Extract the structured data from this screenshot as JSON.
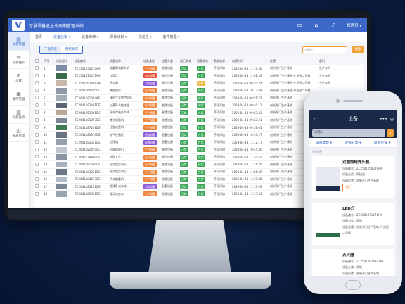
{
  "app": {
    "logo": "V",
    "title": "智慧设备全生命周期管理系统",
    "user": "管理员"
  },
  "topbar_icons": [
    "monitor-icon",
    "home-icon",
    "bell-icon"
  ],
  "sidebar": {
    "items": [
      {
        "icon": "▤",
        "label": "设备管理"
      },
      {
        "icon": "⚒",
        "label": "设备维护"
      },
      {
        "icon": "⚙",
        "label": "设置"
      },
      {
        "icon": "▦",
        "label": "备件管理"
      },
      {
        "icon": "▥",
        "label": "设备盘点"
      },
      {
        "icon": "◫",
        "label": "报表管理"
      }
    ]
  },
  "nav": {
    "tabs": [
      {
        "label": "首页"
      },
      {
        "label": "设备台账 ▾"
      },
      {
        "label": "设备维修 ▾"
      },
      {
        "label": "保养计划 ▾"
      },
      {
        "label": "点巡检 ▾"
      },
      {
        "label": "备件管理 ▾"
      }
    ]
  },
  "filter": {
    "seg": [
      "下发列表",
      "网络状况"
    ],
    "search_placeholder": "请输入",
    "search_label": "搜索"
  },
  "table": {
    "headers": [
      "",
      "序号",
      "设备图片",
      "设备编号",
      "设备名称",
      "设备类型",
      "设备分类",
      "运行状态",
      "设备状态",
      "数据来源",
      "创建时间",
      "位置",
      "部门",
      ""
    ],
    "rows": [
      {
        "n": "1",
        "code": "ZC2501250210HK",
        "name": "双圆筒电焊头机",
        "type": "生产设备",
        "tcolor": "orange",
        "cat": "制造设备",
        "run": "正常",
        "rcolor": "green",
        "state": "在用",
        "scolor": "green",
        "src": "手动添加",
        "time": "2023-04-18 11:13:56",
        "loc": "创新东门生产基地",
        "dept": "生产车间",
        "img": "#7c8ea5"
      },
      {
        "n": "2",
        "code": "ZC2501871071HK",
        "name": "LED灯",
        "type": "办公设备",
        "tcolor": "red",
        "cat": "制造设备",
        "run": "正常",
        "rcolor": "green",
        "state": "在用",
        "scolor": "green",
        "src": "手动添加",
        "time": "2023-04-18 11:01:34",
        "loc": "创新东门生产基地-产业园二号楼",
        "dept": "生产车间",
        "img": "#3a6a4a"
      },
      {
        "n": "3",
        "code": "ZC2501297491ZBF",
        "name": "灭火器",
        "type": "消防设备",
        "tcolor": "purple",
        "cat": "制造设备",
        "run": "正常",
        "rcolor": "green",
        "state": "维修",
        "scolor": "yellow",
        "src": "手动添加",
        "time": "2023-04-18 09:30:24",
        "loc": "创新东门生产基地-产业园二号楼",
        "dept": "生产车间",
        "img": "#c9b7a8"
      },
      {
        "n": "4",
        "code": "ZC2641160585DC",
        "name": "数控铣床",
        "type": "生产设备",
        "tcolor": "orange",
        "cat": "制造设备",
        "run": "正常",
        "rcolor": "green",
        "state": "在用",
        "scolor": "green",
        "src": "手动添加",
        "time": "2023-04-18 10:12:48",
        "loc": "创新东门生产基地-产业园二号楼",
        "dept": "",
        "img": "#8f98a6"
      },
      {
        "n": "5",
        "code": "ZC2641181084KE",
        "name": "精密立式数控机床",
        "type": "生产设备",
        "tcolor": "orange",
        "cat": "制造设备",
        "run": "正常",
        "rcolor": "green",
        "state": "在用",
        "scolor": "green",
        "src": "手动添加",
        "time": "2023-04-18 09:51:27",
        "loc": "创新东门生产基地",
        "dept": "",
        "img": "#a4acb8"
      },
      {
        "n": "6",
        "code": "ZC2641182401DE",
        "name": "三菱PLC控制器",
        "type": "生产设备",
        "tcolor": "orange",
        "cat": "制造设备",
        "run": "正常",
        "rcolor": "green",
        "state": "在用",
        "scolor": "green",
        "src": "手动添加",
        "time": "2023-04-18 09:40:11",
        "loc": "创新东门生产基地",
        "dept": "",
        "img": "#5a6578"
      },
      {
        "n": "7",
        "code": "ZC2641253361DC",
        "name": "粉末涂装生产线",
        "type": "生产设备",
        "tcolor": "orange",
        "cat": "制造设备",
        "run": "正常",
        "rcolor": "green",
        "state": "在用",
        "scolor": "green",
        "src": "手动添加",
        "time": "2023-04-18 09:53:42",
        "loc": "创新东门生产基地",
        "dept": "",
        "img": "#b9a894"
      },
      {
        "n": "8",
        "code": "ZC2641181057DE",
        "name": "激光切割机",
        "type": "生产设备",
        "tcolor": "orange",
        "cat": "制造设备",
        "run": "正常",
        "rcolor": "green",
        "state": "在用",
        "scolor": "green",
        "src": "手动添加",
        "time": "2023-04-18 09:23:41",
        "loc": "创新东门生产基地",
        "dept": "",
        "img": "#7b8592"
      },
      {
        "n": "9",
        "code": "ZC2641187101DE",
        "name": "注塑成型机",
        "type": "生产设备",
        "tcolor": "orange",
        "cat": "制造设备",
        "run": "正常",
        "rcolor": "green",
        "state": "在用",
        "scolor": "green",
        "src": "手动添加",
        "time": "2023-04-18 09:38:01",
        "loc": "创新东门生产基地",
        "dept": "",
        "img": "#3f7a55"
      },
      {
        "n": "10",
        "code": "ZC2641181910DE",
        "name": "电气控制柜",
        "type": "配套设备",
        "tcolor": "purple",
        "cat": "配套设备",
        "run": "正常",
        "rcolor": "green",
        "state": "在用",
        "scolor": "green",
        "src": "手动添加",
        "time": "2023-04-18 10:33:27",
        "loc": "创新东门生产基地",
        "dept": "",
        "img": "#6a7282"
      },
      {
        "n": "11",
        "code": "ZC2641181321DE",
        "name": "空压机",
        "type": "配套设备",
        "tcolor": "purple",
        "cat": "配套设备",
        "run": "正常",
        "rcolor": "green",
        "state": "在用",
        "scolor": "green",
        "src": "手动添加",
        "time": "2023-04-18 11:12:17",
        "loc": "创新东门生产基地",
        "dept": "",
        "img": "#98a0ad"
      },
      {
        "n": "12",
        "code": "ZC2641182450DC",
        "name": "机床防护门",
        "type": "生产设备",
        "tcolor": "orange",
        "cat": "制造设备",
        "run": "正常",
        "rcolor": "green",
        "state": "在用",
        "scolor": "green",
        "src": "手动添加",
        "time": "2023-04-18 10:44:40",
        "loc": "创新东门生产基地",
        "dept": "",
        "img": "#c1c7cf"
      },
      {
        "n": "13",
        "code": "ZC2641178900DE",
        "name": "电动叉车",
        "type": "生产设备",
        "tcolor": "orange",
        "cat": "制造设备",
        "run": "正常",
        "rcolor": "green",
        "state": "在用",
        "scolor": "green",
        "src": "手动添加",
        "time": "2023-04-18 11:30:42",
        "loc": "创新东门生产基地",
        "dept": "",
        "img": "#8c95a3"
      },
      {
        "n": "14",
        "code": "ZC2641181560DE",
        "name": "立式加工中心",
        "type": "生产设备",
        "tcolor": "orange",
        "cat": "制造设备",
        "run": "正常",
        "rcolor": "green",
        "state": "在用",
        "scolor": "green",
        "src": "手动添加",
        "time": "2023-04-18 11:16:20",
        "loc": "创新东门生产基地",
        "dept": "",
        "img": "#a8b0bc"
      },
      {
        "n": "15",
        "code": "ZC2641183021DE",
        "name": "卧式加工中心",
        "type": "生产设备",
        "tcolor": "orange",
        "cat": "制造设备",
        "run": "正常",
        "rcolor": "green",
        "state": "在用",
        "scolor": "green",
        "src": "手动添加",
        "time": "2023-04-18 11:06:39",
        "loc": "创新东门生产基地",
        "dept": "",
        "img": "#6c7686"
      },
      {
        "n": "16",
        "code": "ZC2641184417DE",
        "name": "桥式起重机",
        "type": "生产设备",
        "tcolor": "orange",
        "cat": "制造设备",
        "run": "正常",
        "rcolor": "green",
        "state": "在用",
        "scolor": "green",
        "src": "手动添加",
        "time": "2023-04-18 11:13:36",
        "loc": "创新东门生产基地",
        "dept": "",
        "img": "#b4bcc6"
      },
      {
        "n": "17",
        "code": "ZC2641185121DE",
        "name": "普通卧式车床",
        "type": "消防设备",
        "tcolor": "purple",
        "cat": "配套设备",
        "run": "正常",
        "rcolor": "green",
        "state": "在用",
        "scolor": "green",
        "src": "手动添加",
        "time": "2023-04-18 11:13:39",
        "loc": "创新东门生产基地",
        "dept": "",
        "img": "#7d8796"
      },
      {
        "n": "18",
        "code": "ZC2641186901DE",
        "name": "移动式叉车",
        "type": "生产设备",
        "tcolor": "orange",
        "cat": "制造设备",
        "run": "正常",
        "rcolor": "green",
        "state": "在用",
        "scolor": "green",
        "src": "手动添加",
        "time": "2023-04-18 11:13:41",
        "loc": "创新东门生产基地",
        "dept": "",
        "img": "#9aa3b0"
      }
    ]
  },
  "mobile": {
    "title": "设备",
    "search_placeholder": "请输入",
    "filters": [
      "设备类型 ▾",
      "设备分类 ▾",
      "设备位置 ▾"
    ],
    "count": "共50条",
    "cards": [
      {
        "name": "双圆筒电焊头机",
        "code_label": "设备编号：",
        "code": "ZC2501250210HK",
        "type_label": "设备分类：",
        "type": "焊接机",
        "loc_label": "设备位置：",
        "loc": "创新东门生产基地",
        "tag": "在用",
        "img_color": "#e6e9ef",
        "img_accent": "#1c2a4a"
      },
      {
        "name": "LED灯",
        "code_label": "设备编号：",
        "code": "ZC2501871071HK",
        "type_label": "设备分类：",
        "type": "照明",
        "loc_label": "设备位置：",
        "loc": "创新东门生产基地-产业园二号楼",
        "tag": "",
        "img_color": "#ffffff",
        "img_accent": "#2c6b48"
      },
      {
        "name": "灭火器",
        "code_label": "设备编号：",
        "code": "ZC2501297491ZBF",
        "type_label": "设备分类：",
        "type": "消防",
        "loc_label": "设备位置：",
        "loc": "创新东门生产基地",
        "tag": "",
        "img_color": "#ffffff",
        "img_accent": "#d33a2c"
      }
    ]
  },
  "colors": {
    "primary": "#3c68c9",
    "orange": "#f0833a",
    "red": "#e6543b",
    "purple": "#8a5ad8",
    "green": "#3aa757",
    "yellow": "#e9b43a",
    "mobile_header": "#1c2a4a"
  }
}
